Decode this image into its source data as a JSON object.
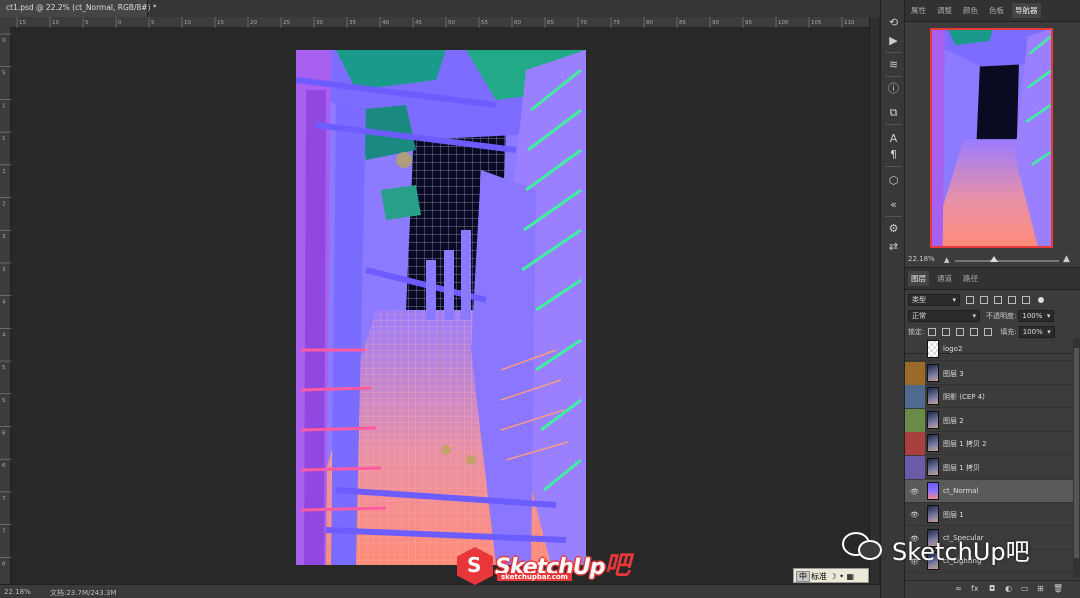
{
  "document": {
    "tab_title": "ct1.psd @ 22.2% (ct_Normal, RGB/8#) *",
    "close_glyph": "×"
  },
  "rulers": {
    "horizontal_ticks": [
      "15",
      "10",
      "5",
      "0",
      "5",
      "10",
      "15",
      "20",
      "25",
      "30",
      "35",
      "40",
      "45",
      "50",
      "55",
      "60",
      "65",
      "70",
      "75",
      "80",
      "85",
      "90",
      "95",
      "100",
      "105",
      "110"
    ],
    "vertical_ticks": [
      "0",
      "5",
      "1",
      "1",
      "2",
      "2",
      "3",
      "3",
      "4",
      "4",
      "5",
      "5",
      "6",
      "6",
      "7",
      "7",
      "8"
    ]
  },
  "status_bar": {
    "zoom": "22.18%",
    "doc_info": "文档:23.7M/243.3M"
  },
  "icon_strip": {
    "icons": [
      "history-icon",
      "play-icon",
      "brush-presets-icon",
      "info-icon",
      "clone-source-icon",
      "character-icon",
      "paragraph-icon",
      "3d-icon",
      "collapse-icon",
      "properties-icon",
      "adjust-icon"
    ]
  },
  "navigator_panel": {
    "tabs": [
      "属性",
      "调整",
      "颜色",
      "色板",
      "导航器"
    ],
    "active_tab": "导航器",
    "zoom": "22.18%",
    "proxy_color": "#e63a3a"
  },
  "layers_panel": {
    "tabs": [
      "图层",
      "通道",
      "路径"
    ],
    "active_tab": "图层",
    "filter_label": "类型",
    "blend_mode": "正常",
    "opacity_label": "不透明度:",
    "opacity_value": "100%",
    "lock_label": "锁定:",
    "fill_label": "填充:",
    "fill_value": "100%",
    "layers": [
      {
        "name": "logo2",
        "color": "",
        "visible": false,
        "selected": false,
        "thumb": "logo"
      },
      {
        "name": "图层 3",
        "color": "#9a6a2a",
        "visible": false,
        "selected": false,
        "thumb": "render"
      },
      {
        "name": "阴影 (CEP 4)",
        "color": "#4e6a8e",
        "visible": false,
        "selected": false,
        "thumb": "render"
      },
      {
        "name": "图层 2",
        "color": "#6a8a4a",
        "visible": false,
        "selected": false,
        "thumb": "render"
      },
      {
        "name": "图层 1 拷贝 2",
        "color": "#a84040",
        "visible": false,
        "selected": false,
        "thumb": "render"
      },
      {
        "name": "图层 1 拷贝",
        "color": "#6a5aa8",
        "visible": false,
        "selected": false,
        "thumb": "render"
      },
      {
        "name": "ct_Normal",
        "color": "",
        "visible": true,
        "selected": true,
        "thumb": "normal"
      },
      {
        "name": "图层 1",
        "color": "",
        "visible": true,
        "selected": false,
        "thumb": "render"
      },
      {
        "name": "ct_Specular",
        "color": "",
        "visible": true,
        "selected": false,
        "thumb": "render"
      },
      {
        "name": "ct_Lighting",
        "color": "",
        "visible": true,
        "selected": false,
        "thumb": "render"
      }
    ],
    "footer_icons": [
      "link-icon",
      "fx-icon",
      "mask-icon",
      "adjustment-icon",
      "group-icon",
      "new-layer-icon",
      "trash-icon"
    ]
  },
  "watermarks": {
    "logo_brand": "SketchUp",
    "logo_brand_cn": "吧",
    "logo_url": "sketchupbar.com",
    "wechat_text": "SketchUp吧"
  },
  "ime_bar": {
    "label": "标准"
  }
}
